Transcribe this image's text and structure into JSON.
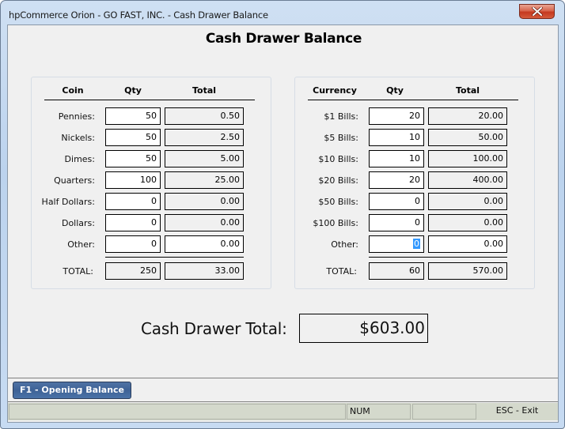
{
  "window": {
    "title": "hpCommerce Orion - GO FAST, INC. - Cash Drawer Balance",
    "close_icon": "close-x-icon"
  },
  "page": {
    "title": "Cash Drawer Balance"
  },
  "coin_section": {
    "headers": {
      "name": "Coin",
      "qty": "Qty",
      "total": "Total"
    },
    "rows": [
      {
        "label": "Pennies:",
        "qty": "50",
        "total": "0.50"
      },
      {
        "label": "Nickels:",
        "qty": "50",
        "total": "2.50"
      },
      {
        "label": "Dimes:",
        "qty": "50",
        "total": "5.00"
      },
      {
        "label": "Quarters:",
        "qty": "100",
        "total": "25.00"
      },
      {
        "label": "Half Dollars:",
        "qty": "0",
        "total": "0.00"
      },
      {
        "label": "Dollars:",
        "qty": "0",
        "total": "0.00"
      },
      {
        "label": "Other:",
        "qty": "0",
        "total": "0.00"
      }
    ],
    "total_row": {
      "label": "TOTAL:",
      "qty": "250",
      "total": "33.00"
    }
  },
  "currency_section": {
    "headers": {
      "name": "Currency",
      "qty": "Qty",
      "total": "Total"
    },
    "rows": [
      {
        "label": "$1 Bills:",
        "qty": "20",
        "total": "20.00"
      },
      {
        "label": "$5 Bills:",
        "qty": "10",
        "total": "50.00"
      },
      {
        "label": "$10 Bills:",
        "qty": "10",
        "total": "100.00"
      },
      {
        "label": "$20 Bills:",
        "qty": "20",
        "total": "400.00"
      },
      {
        "label": "$50 Bills:",
        "qty": "0",
        "total": "0.00"
      },
      {
        "label": "$100 Bills:",
        "qty": "0",
        "total": "0.00"
      },
      {
        "label": "Other:",
        "qty": "0",
        "total": "0.00"
      }
    ],
    "total_row": {
      "label": "TOTAL:",
      "qty": "60",
      "total": "570.00"
    }
  },
  "drawer": {
    "label": "Cash Drawer Total:",
    "value": "$603.00"
  },
  "buttons": {
    "opening_balance": "F1 - Opening Balance"
  },
  "statusbar": {
    "panel1": "",
    "num": "NUM",
    "panel3": "",
    "exit": "ESC - Exit"
  },
  "colors": {
    "button_blue": "#3e6296",
    "close_red": "#c5391f",
    "statusbar_bg": "#d4d9cc",
    "selection": "#3399ff"
  }
}
